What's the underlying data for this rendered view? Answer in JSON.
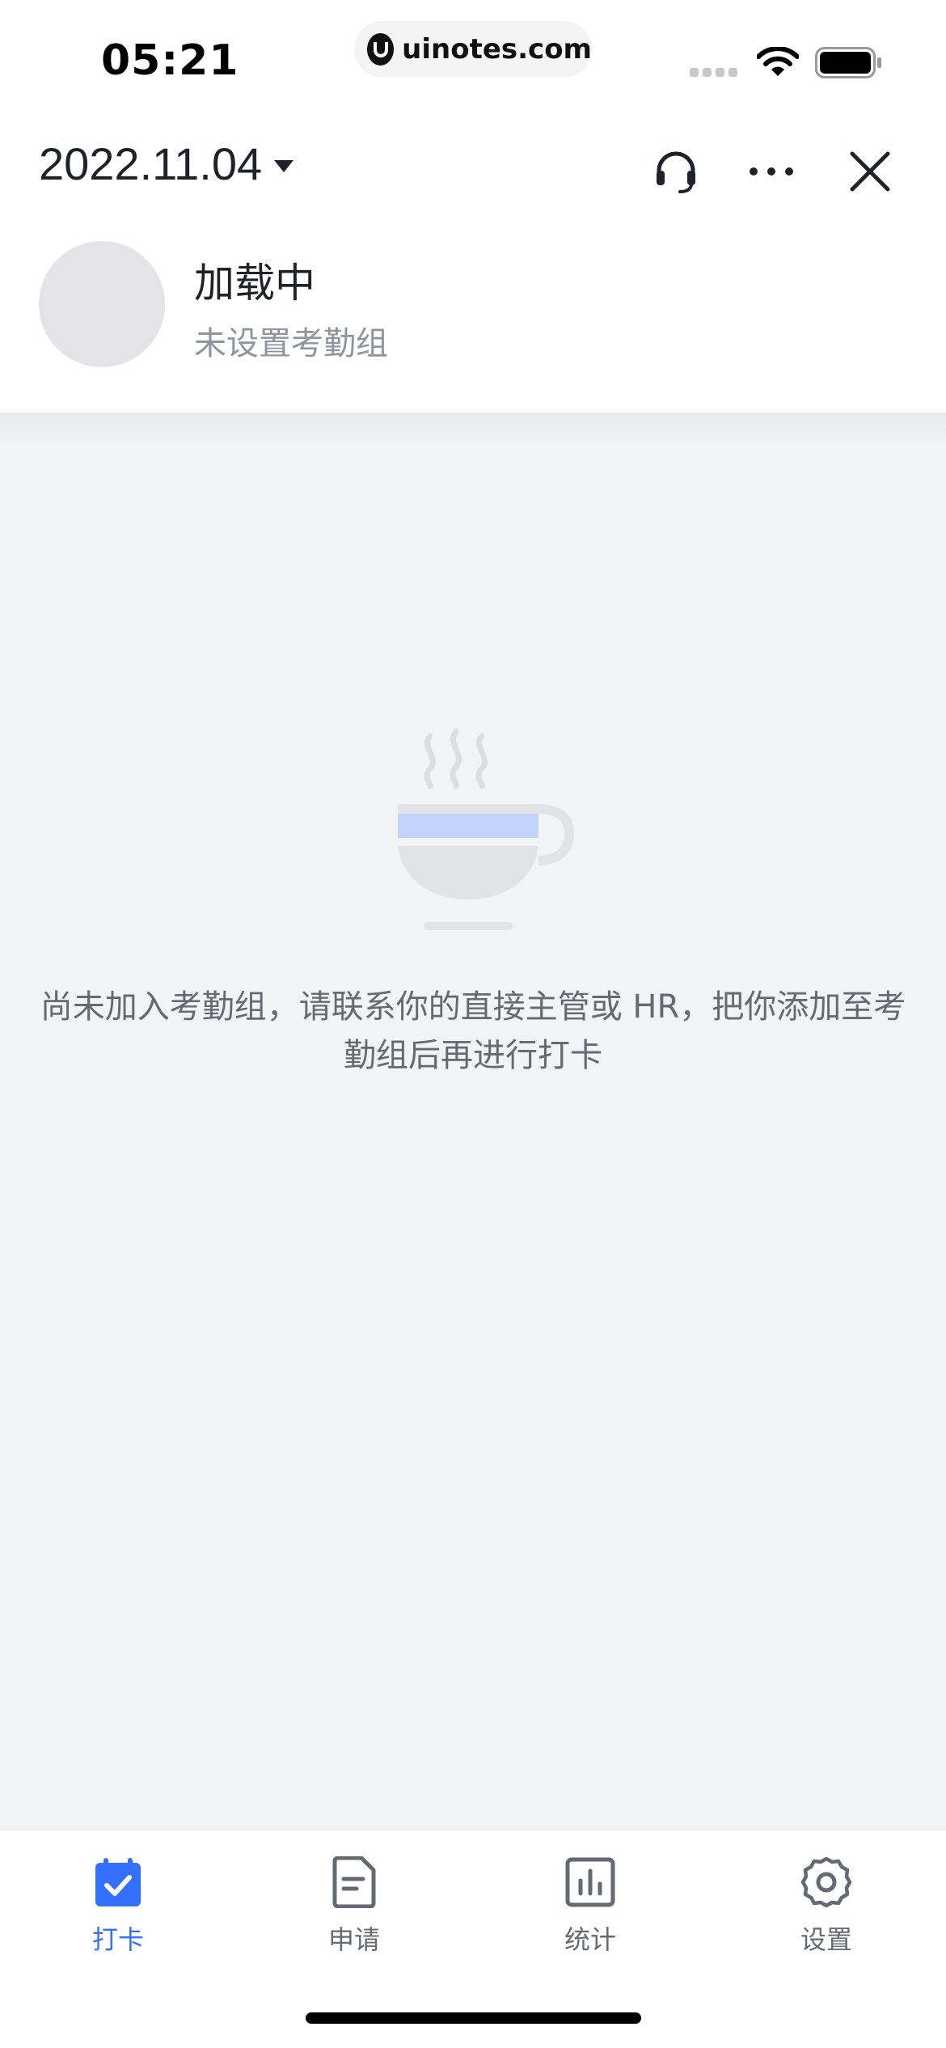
{
  "status_bar": {
    "time": "05:21",
    "url": "uinotes.com"
  },
  "header": {
    "date": "2022.11.04",
    "user_name": "加载中",
    "group_status": "未设置考勤组",
    "icons": [
      "headset-icon",
      "more-icon",
      "close-icon"
    ]
  },
  "empty_state": {
    "icon": "coffee-cup-icon",
    "message": "尚未加入考勤组，请联系你的直接主管或 HR，把你添加至考勤组后再进行打卡"
  },
  "tabs": [
    {
      "label": "打卡",
      "icon": "checkin-calendar-icon",
      "active": true
    },
    {
      "label": "申请",
      "icon": "document-icon",
      "active": false
    },
    {
      "label": "统计",
      "icon": "bar-chart-icon",
      "active": false
    },
    {
      "label": "设置",
      "icon": "gear-icon",
      "active": false
    }
  ],
  "colors": {
    "accent": "#3370ff",
    "text_primary": "#1f2329",
    "text_secondary": "#8f959e",
    "background": "#f2f3f5"
  }
}
